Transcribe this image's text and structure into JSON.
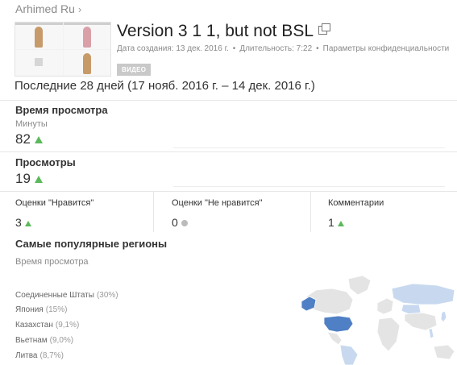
{
  "breadcrumb": {
    "channel": "Arhimed Ru",
    "chevron": "›"
  },
  "video": {
    "title": "Version 3 1 1, but not BSL",
    "created": "Дата создания: 13 дек. 2016 г.",
    "duration": "Длительность: 7:22",
    "privacy": "Параметры конфиденциальности",
    "badge": "ВИДЕО"
  },
  "period": "Последние 28 дней (17 нояб. 2016 г. – 14 дек. 2016 г.)",
  "watch_time": {
    "title": "Время просмотра",
    "unit": "Минуты",
    "value": "82"
  },
  "views": {
    "title": "Просмотры",
    "value": "19"
  },
  "likes": {
    "label": "Оценки \"Нравится\"",
    "value": "3"
  },
  "dislikes": {
    "label": "Оценки \"Не нравится\"",
    "value": "0"
  },
  "comments": {
    "label": "Комментарии",
    "value": "1"
  },
  "regions": {
    "title": "Самые популярные регионы",
    "subtitle": "Время просмотра",
    "items": [
      {
        "name": "Соединенные Штаты",
        "pct": "(30%)"
      },
      {
        "name": "Япония",
        "pct": "(15%)"
      },
      {
        "name": "Казахстан",
        "pct": "(9,1%)"
      },
      {
        "name": "Вьетнам",
        "pct": "(9,0%)"
      },
      {
        "name": "Литва",
        "pct": "(8,7%)"
      }
    ]
  },
  "colors": {
    "trend_up": "#5cb85c",
    "map_high": "#4f7fc4",
    "map_low": "#c8d9ef",
    "map_none": "#e4e4e4"
  }
}
